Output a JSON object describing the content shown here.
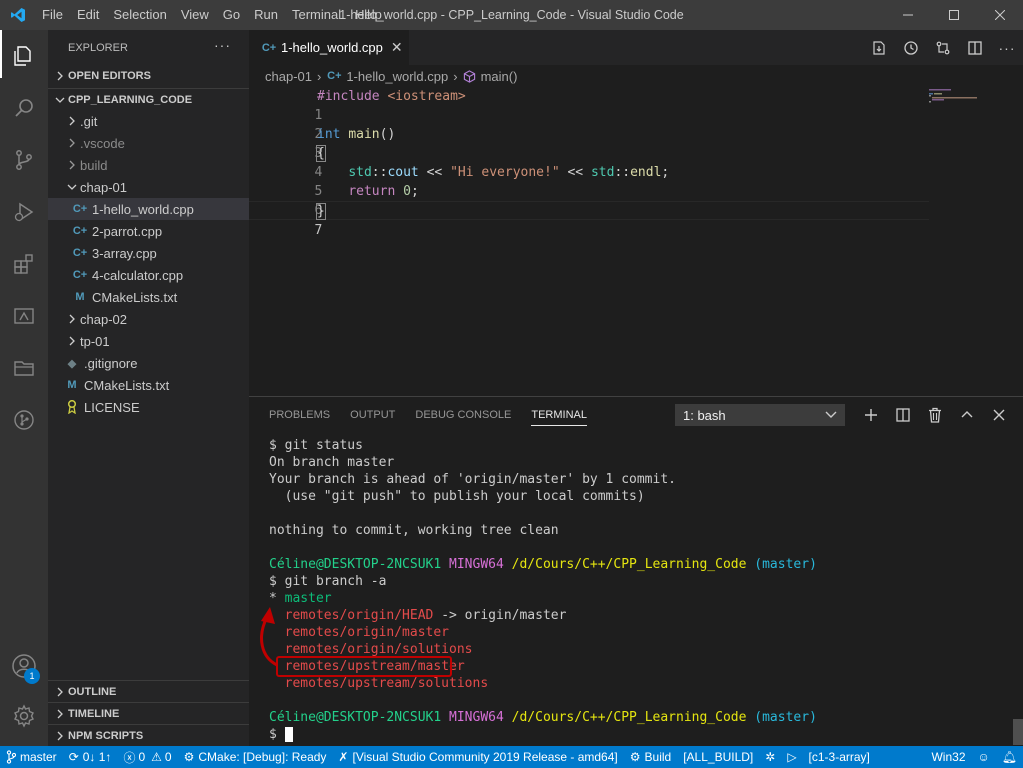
{
  "window": {
    "title": "1-hello_world.cpp - CPP_Learning_Code - Visual Studio Code",
    "menu": [
      "File",
      "Edit",
      "Selection",
      "View",
      "Go",
      "Run",
      "Terminal",
      "Help"
    ]
  },
  "sidebar": {
    "header": "EXPLORER",
    "open_editors": "OPEN EDITORS",
    "workspace": "CPP_LEARNING_CODE",
    "tree": [
      {
        "label": ".git",
        "type": "folder",
        "depth": 1,
        "dim": false
      },
      {
        "label": ".vscode",
        "type": "folder",
        "depth": 1,
        "dim": true
      },
      {
        "label": "build",
        "type": "folder",
        "depth": 1,
        "dim": true
      },
      {
        "label": "chap-01",
        "type": "folder-open",
        "depth": 1,
        "dim": false
      },
      {
        "label": "1-hello_world.cpp",
        "type": "cpp",
        "depth": 2,
        "selected": true
      },
      {
        "label": "2-parrot.cpp",
        "type": "cpp",
        "depth": 2
      },
      {
        "label": "3-array.cpp",
        "type": "cpp",
        "depth": 2
      },
      {
        "label": "4-calculator.cpp",
        "type": "cpp",
        "depth": 2
      },
      {
        "label": "CMakeLists.txt",
        "type": "cmake",
        "depth": 2
      },
      {
        "label": "chap-02",
        "type": "folder",
        "depth": 1
      },
      {
        "label": "tp-01",
        "type": "folder",
        "depth": 1
      },
      {
        "label": ".gitignore",
        "type": "gitignore",
        "depth": 1
      },
      {
        "label": "CMakeLists.txt",
        "type": "cmake",
        "depth": 1
      },
      {
        "label": "LICENSE",
        "type": "license",
        "depth": 1
      }
    ],
    "outline": "OUTLINE",
    "timeline": "TIMELINE",
    "npm_scripts": "NPM SCRIPTS"
  },
  "editor": {
    "tab_label": "1-hello_world.cpp",
    "breadcrumb": {
      "folder": "chap-01",
      "file": "1-hello_world.cpp",
      "symbol": "main()"
    },
    "lines": {
      "l1_pp": "#include",
      "l1_inc": "<iostream>",
      "l3_kw": "int",
      "l3_fn": "main",
      "l3_rest": "()",
      "l4": "{",
      "l5_ns1": "std",
      "l5_sep1": "::",
      "l5_var": "cout",
      "l5_op1": " << ",
      "l5_str": "\"Hi everyone!\"",
      "l5_op2": " << ",
      "l5_ns2": "std",
      "l5_sep2": "::",
      "l5_fn": "endl",
      "l5_end": ";",
      "l6_kw": "return",
      "l6_num": "0",
      "l6_end": ";",
      "l7": "}"
    },
    "line_numbers": [
      "1",
      "2",
      "3",
      "4",
      "5",
      "6",
      "7"
    ]
  },
  "panel": {
    "tabs": [
      "PROBLEMS",
      "OUTPUT",
      "DEBUG CONSOLE",
      "TERMINAL"
    ],
    "terminal_select": "1: bash",
    "terminal": {
      "l1": "$ git status",
      "l2": "On branch master",
      "l3": "Your branch is ahead of 'origin/master' by 1 commit.",
      "l4": "  (use \"git push\" to publish your local commits)",
      "l6": "nothing to commit, working tree clean",
      "prompt_user": "Céline@DESKTOP-2NCSUK1",
      "prompt_env": "MINGW64",
      "prompt_path": "/d/Cours/C++/CPP_Learning_Code",
      "prompt_branch": "(master)",
      "cmd2": "$ git branch -a",
      "b_star": "* ",
      "b_master": "master",
      "b_head_red": "  remotes/origin/HEAD",
      "b_head_rest": " -> origin/master",
      "b_origin_master": "  remotes/origin/master",
      "b_origin_solutions": "  remotes/origin/solutions",
      "b_upstream_master": "remotes/upstream/master",
      "b_upstream_solutions": "  remotes/upstream/solutions",
      "prompt_user2": "Céline@DESKTOP-2NCSUK1",
      "prompt_env2": "MINGW64",
      "prompt_path2": "/d/Cours/C++/CPP_Learning_Code",
      "prompt_branch2": "(master)",
      "final": "$ "
    }
  },
  "activity": {
    "accounts_badge": "1"
  },
  "statusbar": {
    "branch": "master",
    "sync": "0↓ 1↑",
    "errors": "0",
    "warnings": "0",
    "cmake": "CMake: [Debug]: Ready",
    "kit": "[Visual Studio Community 2019 Release - amd64]",
    "build": "Build",
    "target": "[ALL_BUILD]",
    "launch": "[c1-3-array]",
    "platform": "Win32"
  },
  "colors": {
    "accent": "#007acc",
    "annotation_red": "#c00000"
  }
}
